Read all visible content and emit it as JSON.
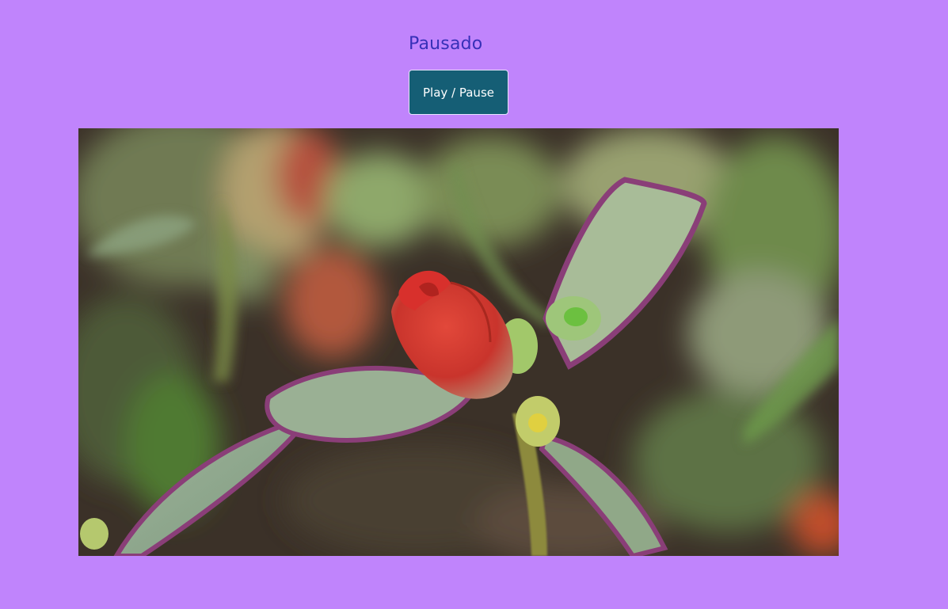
{
  "player": {
    "status_text": "Pausado",
    "button_label": "Play / Pause",
    "state": "paused"
  },
  "video": {
    "subject": "red-flower-bud-icon"
  },
  "colors": {
    "page_background": "#c084fc",
    "status_text": "#3730b8",
    "button_background": "#155e75",
    "button_text": "#ffffff"
  }
}
